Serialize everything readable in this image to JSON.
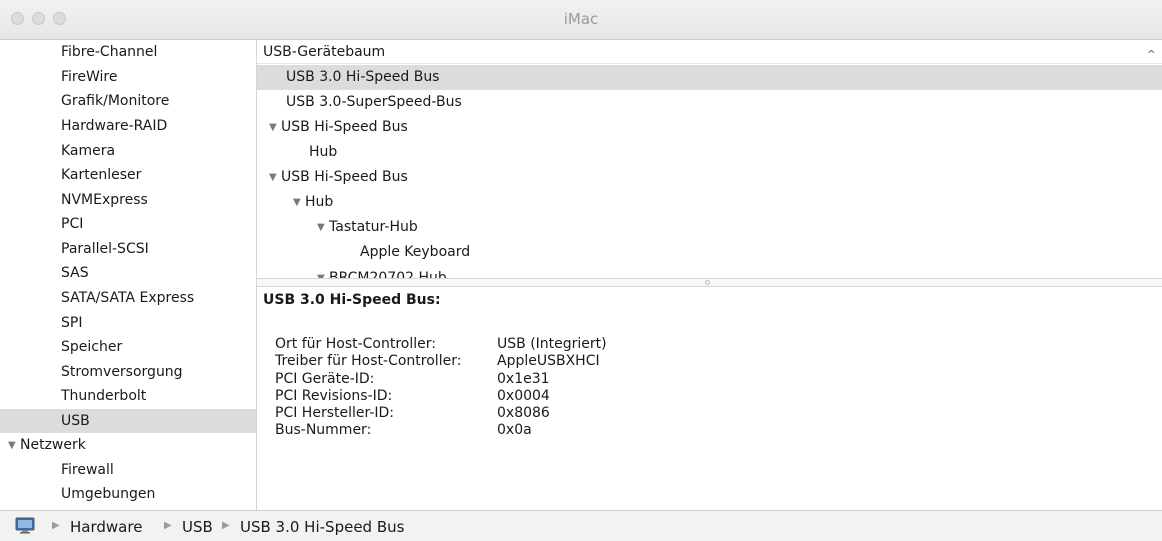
{
  "window": {
    "title": "iMac"
  },
  "sidebar": {
    "items": [
      {
        "label": "Fibre-Channel"
      },
      {
        "label": "FireWire"
      },
      {
        "label": "Grafik/Monitore"
      },
      {
        "label": "Hardware-RAID"
      },
      {
        "label": "Kamera"
      },
      {
        "label": "Kartenleser"
      },
      {
        "label": "NVMExpress"
      },
      {
        "label": "PCI"
      },
      {
        "label": "Parallel-SCSI"
      },
      {
        "label": "SAS"
      },
      {
        "label": "SATA/SATA Express"
      },
      {
        "label": "SPI"
      },
      {
        "label": "Speicher"
      },
      {
        "label": "Stromversorgung"
      },
      {
        "label": "Thunderbolt"
      },
      {
        "label": "USB",
        "selected": true
      },
      {
        "label": "Netzwerk",
        "category": true
      },
      {
        "label": "Firewall"
      },
      {
        "label": "Umgebungen"
      }
    ]
  },
  "tree": {
    "header": "USB-Gerätebaum",
    "rows": [
      {
        "label": "USB 3.0 Hi-Speed Bus",
        "selected": true
      },
      {
        "label": "USB 3.0-SuperSpeed-Bus"
      },
      {
        "label": "USB Hi-Speed Bus",
        "expanded": true
      },
      {
        "label": "Hub"
      },
      {
        "label": "USB Hi-Speed Bus",
        "expanded": true
      },
      {
        "label": "Hub",
        "expanded": true
      },
      {
        "label": "Tastatur-Hub",
        "expanded": true
      },
      {
        "label": "Apple Keyboard"
      },
      {
        "label": "BRCM20702 Hub",
        "expanded": true
      }
    ]
  },
  "detail": {
    "title": "USB 3.0 Hi-Speed Bus:",
    "properties": [
      {
        "label": "Ort für Host-Controller:",
        "value": "USB (Integriert)"
      },
      {
        "label": "Treiber für Host-Controller:",
        "value": "AppleUSBXHCI"
      },
      {
        "label": "PCI Geräte-ID:",
        "value": "0x1e31"
      },
      {
        "label": "PCI Revisions-ID:",
        "value": "0x0004"
      },
      {
        "label": "PCI Hersteller-ID:",
        "value": "0x8086"
      },
      {
        "label": "Bus-Nummer:",
        "value": "0x0a"
      }
    ]
  },
  "breadcrumb": {
    "icon": "imac-icon",
    "items": [
      "Hardware",
      "USB",
      "USB 3.0 Hi-Speed Bus"
    ]
  }
}
